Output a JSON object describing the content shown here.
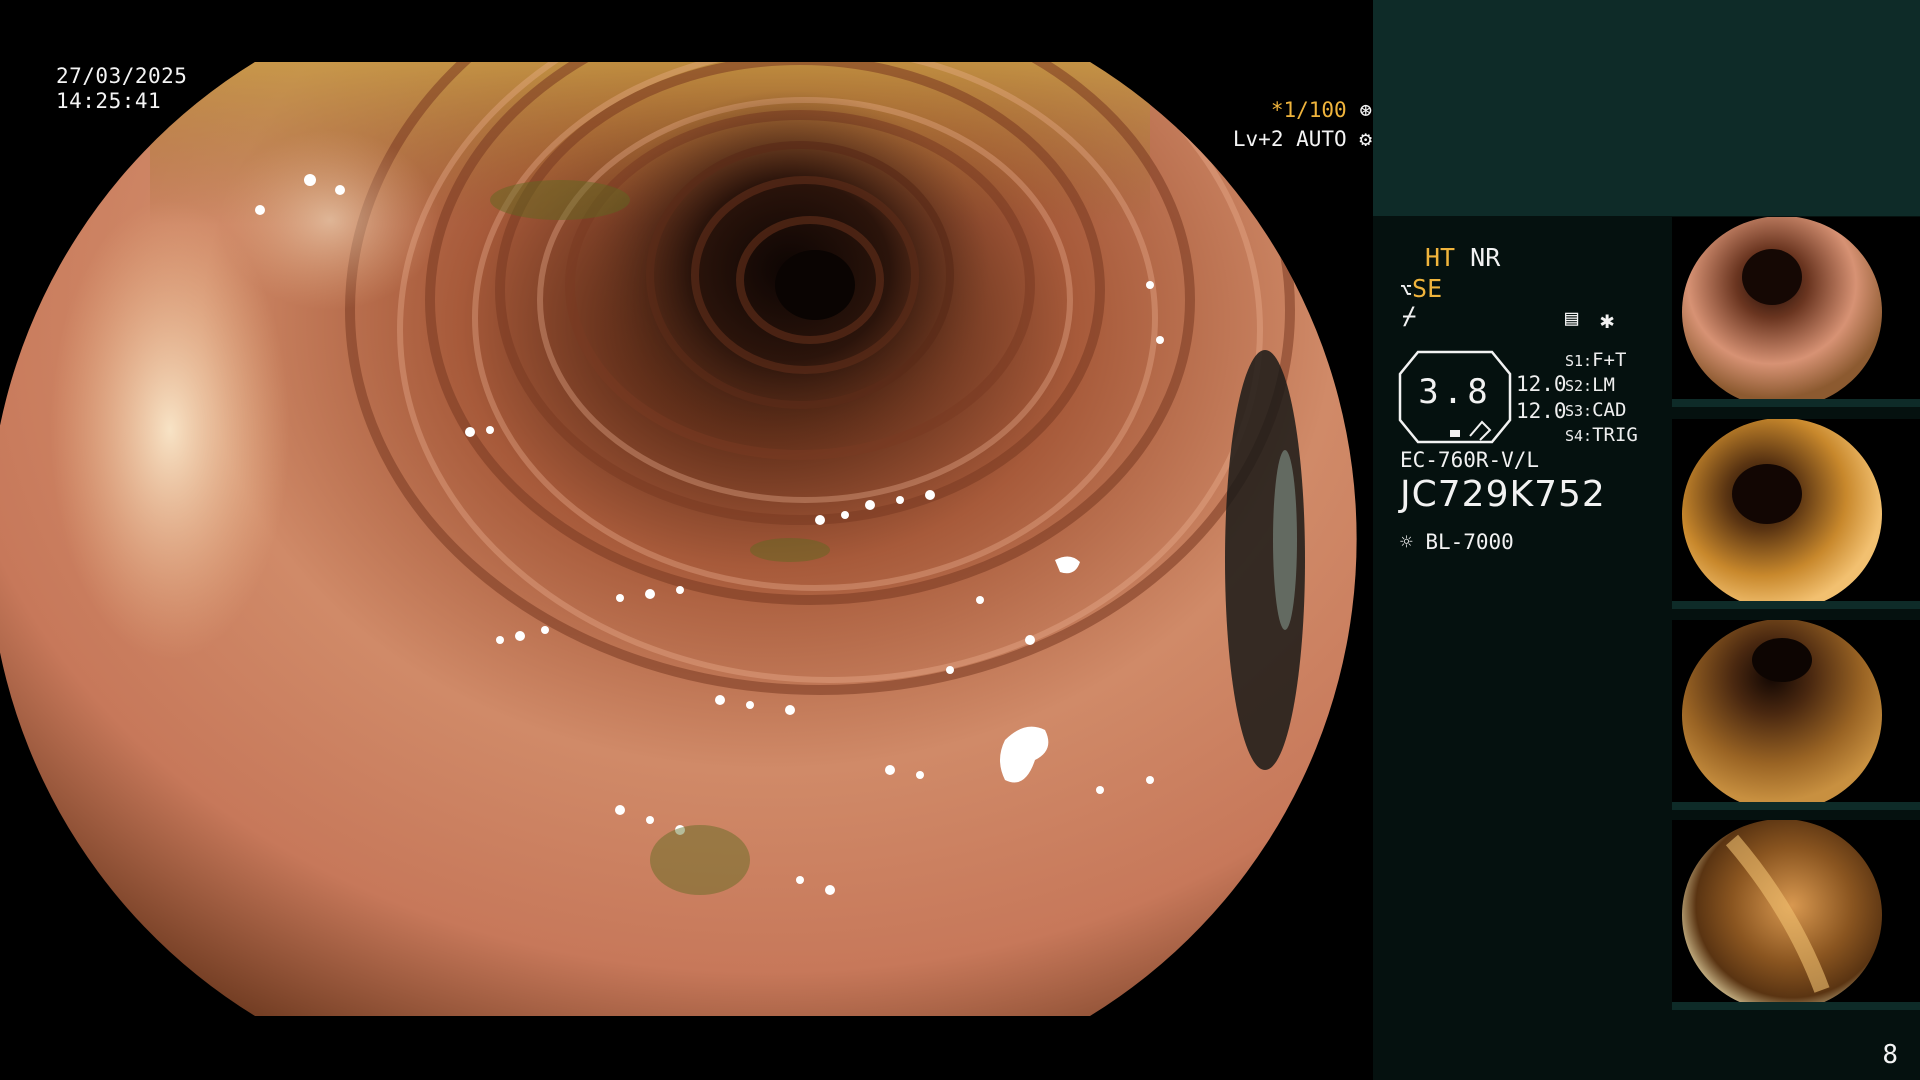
{
  "overlay": {
    "date": "27/03/2025",
    "time": "14:25:41",
    "shutter": "*1/100",
    "level": "Lv+2 AUTO"
  },
  "panel": {
    "ht": "HT",
    "nr": "NR",
    "se": "SE",
    "gauge_value": "3.8",
    "val_1": "12.0",
    "val_2": "12.0",
    "settings": [
      {
        "key": "S1:",
        "value": "F+T"
      },
      {
        "key": "S2:",
        "value": "LM"
      },
      {
        "key": "S3:",
        "value": "CAD"
      },
      {
        "key": "S4:",
        "value": "TRIG"
      }
    ],
    "scope_model": "EC-760R-V/L",
    "serial": "JC729K752",
    "light_source": "BL-7000",
    "page_number": "8"
  },
  "icons": [
    "fan-icon",
    "gear-icon",
    "scope-icon",
    "flash-icon",
    "memo-icon",
    "star-icon",
    "sun-icon"
  ],
  "colors": {
    "accent": "#f0b43c",
    "panel_bg": "#05110f",
    "panel_top": "#0e2b28"
  }
}
